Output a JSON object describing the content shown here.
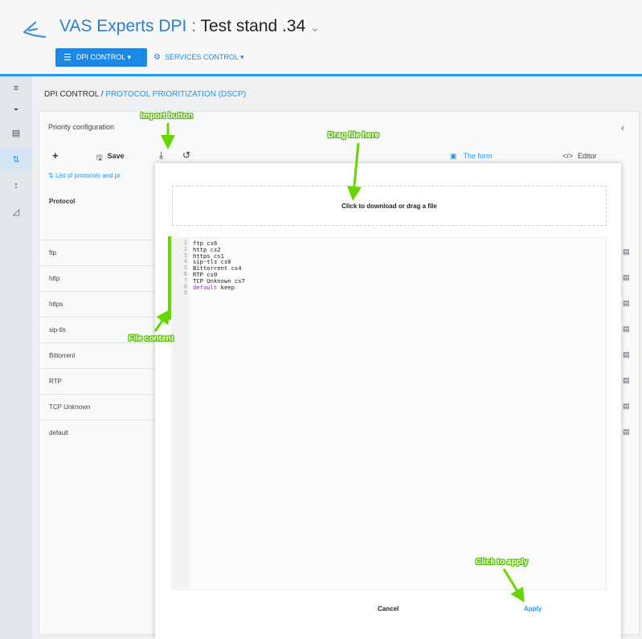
{
  "header": {
    "brand": "VAS Experts DPI",
    "separator": ":",
    "stand": "Test stand .34",
    "stand_chevron": "⌄",
    "dpi_control": "DPI CONTROL ▾",
    "services_control": "SERVICES CONTROL ▾"
  },
  "breadcrumb": {
    "root": "DPI CONTROL",
    "sep": " / ",
    "current": "PROTOCOL PRIORITIZATION (DSCP)"
  },
  "panel": {
    "title": "Priority configuration",
    "collapse": "‹",
    "toolbar": {
      "add": "+",
      "save": "Save",
      "tab_form": "The form",
      "tab_editor": "Editor"
    },
    "list_link": "List of protocols and pr",
    "column_protocol": "Protocol",
    "rows": [
      "ftp",
      "http",
      "https",
      "sip-tls",
      "Bittorrent",
      "RTP",
      "TCP Unknown",
      "default"
    ]
  },
  "modal": {
    "dropzone": "Click to download or drag a file",
    "code_lines": [
      "ftp cs6",
      "http cs2",
      "https cs1",
      "sip-tls cs0",
      "Bittorrent cs4",
      "RTP cs0",
      "TCP Unknown cs7",
      "default keep",
      ""
    ],
    "cancel": "Cancel",
    "apply": "Apply"
  },
  "annotations": {
    "import_button": "Import button",
    "drag_file": "Drag file here",
    "file_content": "File content",
    "click_apply": "Click to apply"
  },
  "colors": {
    "accent": "#2196f3",
    "annotation": "#66d600"
  },
  "icons": {
    "logo": "vas-logo-icon",
    "nav": [
      "menu-icon",
      "dashboard-icon",
      "list-icon",
      "sort-icon",
      "sort-numeric-icon",
      "chart-icon"
    ]
  }
}
